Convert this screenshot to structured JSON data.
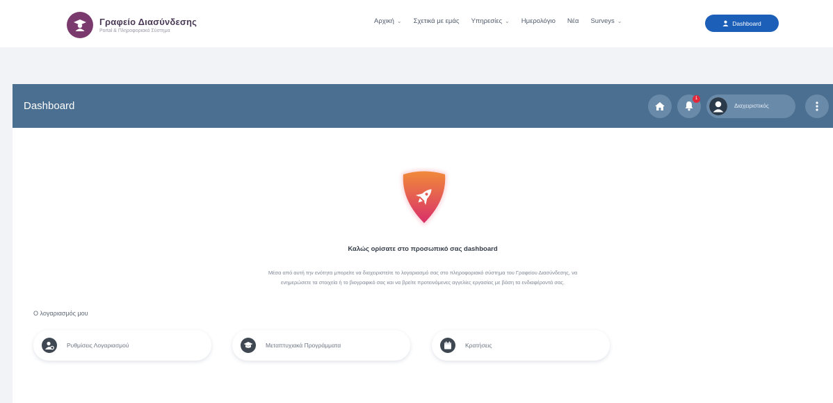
{
  "brand": {
    "title": "Γραφείο Διασύνδεσης",
    "subtitle": "Portal & Πληροφοριακό Σύστημα"
  },
  "nav": {
    "items": [
      {
        "label": "Αρχική",
        "dropdown": true
      },
      {
        "label": "Σχετικά με εμάς",
        "dropdown": false
      },
      {
        "label": "Υπηρεσίες",
        "dropdown": true
      },
      {
        "label": "Ημερολόγιο",
        "dropdown": false
      },
      {
        "label": "Νέα",
        "dropdown": false
      },
      {
        "label": "Surveys",
        "dropdown": true
      }
    ],
    "dashboard_button": "Dashboard"
  },
  "card": {
    "title": "Dashboard",
    "notification_count": "1",
    "user_label": "Διαχειριστικός"
  },
  "welcome": {
    "title": "Καλώς ορίσατε στο προσωπικό σας dashboard",
    "description_line1": "Μέσα από αυτή την ενότητα μπορείτε να διαχειριστείτε το λογαριασμό σας στο πληροφοριακό σύστημα του Γραφείου Διασύνδεσης, να",
    "description_line2": "ενημερώσετε τα στοιχεία ή το βιογραφικό σας και να βρείτε προτεινόμενες αγγελίες εργασίας με βάση τα ενδιαφέροντά σας."
  },
  "account": {
    "section_label": "Ο λογαριασμός μου",
    "tiles": [
      {
        "label": "Ρυθμίσεις Λογαριασμού",
        "icon": "user-cog-icon"
      },
      {
        "label": "Μεταπτυχιακά Προγράμματα",
        "icon": "graduation-cap-icon"
      },
      {
        "label": "Κρατήσεις",
        "icon": "calendar-icon"
      }
    ]
  },
  "colors": {
    "header": "#4a6f91",
    "brand_button": "#1c5fb8",
    "badge": "#e0293b"
  }
}
